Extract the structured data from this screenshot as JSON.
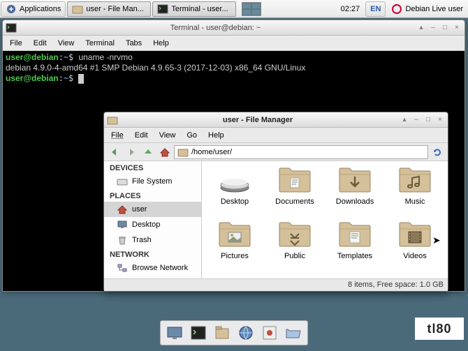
{
  "panel": {
    "apps_label": "Applications",
    "task1": "user - File Man...",
    "task2": "Terminal - user...",
    "clock": "02:27",
    "kbd": "EN",
    "session": "Debian Live user"
  },
  "terminal": {
    "title": "Terminal - user@debian: ~",
    "menu": {
      "file": "File",
      "edit": "Edit",
      "view": "View",
      "terminal": "Terminal",
      "tabs": "Tabs",
      "help": "Help"
    },
    "line1_user": "user@debian",
    "line1_path": "~",
    "line1_cmd": "uname -nrvmo",
    "line2": "debian 4.9.0-4-amd64 #1 SMP Debian 4.9.65-3 (2017-12-03) x86_64 GNU/Linux",
    "line3_user": "user@debian",
    "line3_path": "~"
  },
  "fm": {
    "title": "user - File Manager",
    "menu": {
      "file": "File",
      "edit": "Edit",
      "view": "View",
      "go": "Go",
      "help": "Help"
    },
    "path": "/home/user/",
    "sidebar": {
      "devices_head": "DEVICES",
      "filesystem": "File System",
      "places_head": "PLACES",
      "user": "user",
      "desktop": "Desktop",
      "trash": "Trash",
      "network_head": "NETWORK",
      "browse": "Browse Network"
    },
    "icons": {
      "desktop": "Desktop",
      "documents": "Documents",
      "downloads": "Downloads",
      "music": "Music",
      "pictures": "Pictures",
      "public": "Public",
      "templates": "Templates",
      "videos": "Videos"
    },
    "status": "8 items, Free space: 1.0 GB"
  },
  "watermark": "tl80"
}
